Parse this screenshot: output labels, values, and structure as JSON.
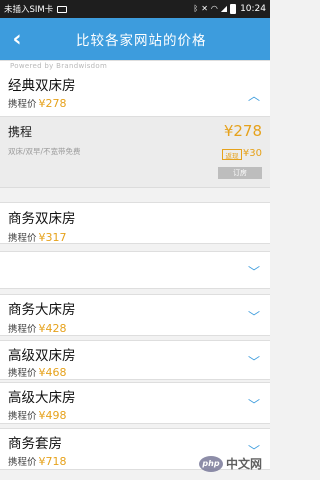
{
  "status_bar": {
    "carrier": "未插入SIM卡",
    "icons": [
      "image-icon",
      "bluetooth-icon",
      "mute-icon",
      "wifi-icon",
      "signal-icon",
      "battery-icon"
    ],
    "time": "10:24"
  },
  "app_bar": {
    "back_icon": "chevron-left-icon",
    "title": "比较各家网站的价格"
  },
  "powered_by": "Powered by Brandwisdom",
  "price_prefix": "携程价",
  "rooms": [
    {
      "name": "经典双床房",
      "price": "¥278",
      "chevron": "chevron-up-icon"
    },
    {
      "name": "商务双床房",
      "price": "¥317"
    },
    {
      "name": "",
      "price": "",
      "chevron": "chevron-down-icon"
    },
    {
      "name": "商务大床房",
      "price": "¥428",
      "chevron": "chevron-down-icon"
    },
    {
      "name": "高级双床房",
      "price": "¥468",
      "chevron": "chevron-down-icon"
    },
    {
      "name": "高级大床房",
      "price": "¥498",
      "chevron": "chevron-down-icon"
    },
    {
      "name": "商务套房",
      "price": "¥718",
      "chevron": "chevron-down-icon"
    }
  ],
  "provider": {
    "name": "携程",
    "subtitle": "双床/双早/不宽带免费",
    "price": "¥278",
    "cashback_tag": "返现",
    "cashback": "¥30",
    "button": "订房"
  },
  "watermark": {
    "logo": "php",
    "text": "中文网"
  },
  "colors": {
    "accent": "#3d9cdd",
    "price": "#e6a21c",
    "status_bar": "#1e1e1e"
  }
}
